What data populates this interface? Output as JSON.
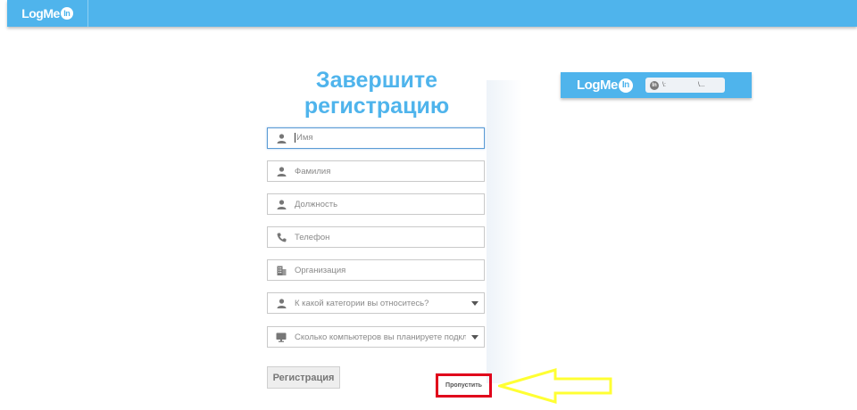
{
  "topbar": {
    "brand_text": "LogMe",
    "brand_badge": "In"
  },
  "form": {
    "title": "Завершите регистрацию",
    "fields": [
      {
        "placeholder": "Имя",
        "icon": "person-icon",
        "focused": true
      },
      {
        "placeholder": "Фамилия",
        "icon": "person-icon"
      },
      {
        "placeholder": "Должность",
        "icon": "person-icon"
      },
      {
        "placeholder": "Телефон",
        "icon": "phone-icon"
      },
      {
        "placeholder": "Организация",
        "icon": "building-icon"
      },
      {
        "placeholder": "К какой категории вы относитесь?",
        "icon": "person-icon",
        "dropdown": true
      },
      {
        "placeholder": "Сколько компьютеров вы планируете подключи",
        "icon": "monitor-icon",
        "dropdown": true
      }
    ],
    "register_label": "Регистрация",
    "skip_label": "Пропустить"
  },
  "preview": {
    "brand_text": "LogMe",
    "brand_badge": "In",
    "pill_badge": "In",
    "pill_text_left": "\\:",
    "pill_text_right": "\\..."
  },
  "colors": {
    "brand_blue": "#4fb4ec",
    "highlight_red": "#e0001b",
    "arrow_yellow": "#ffff33"
  }
}
